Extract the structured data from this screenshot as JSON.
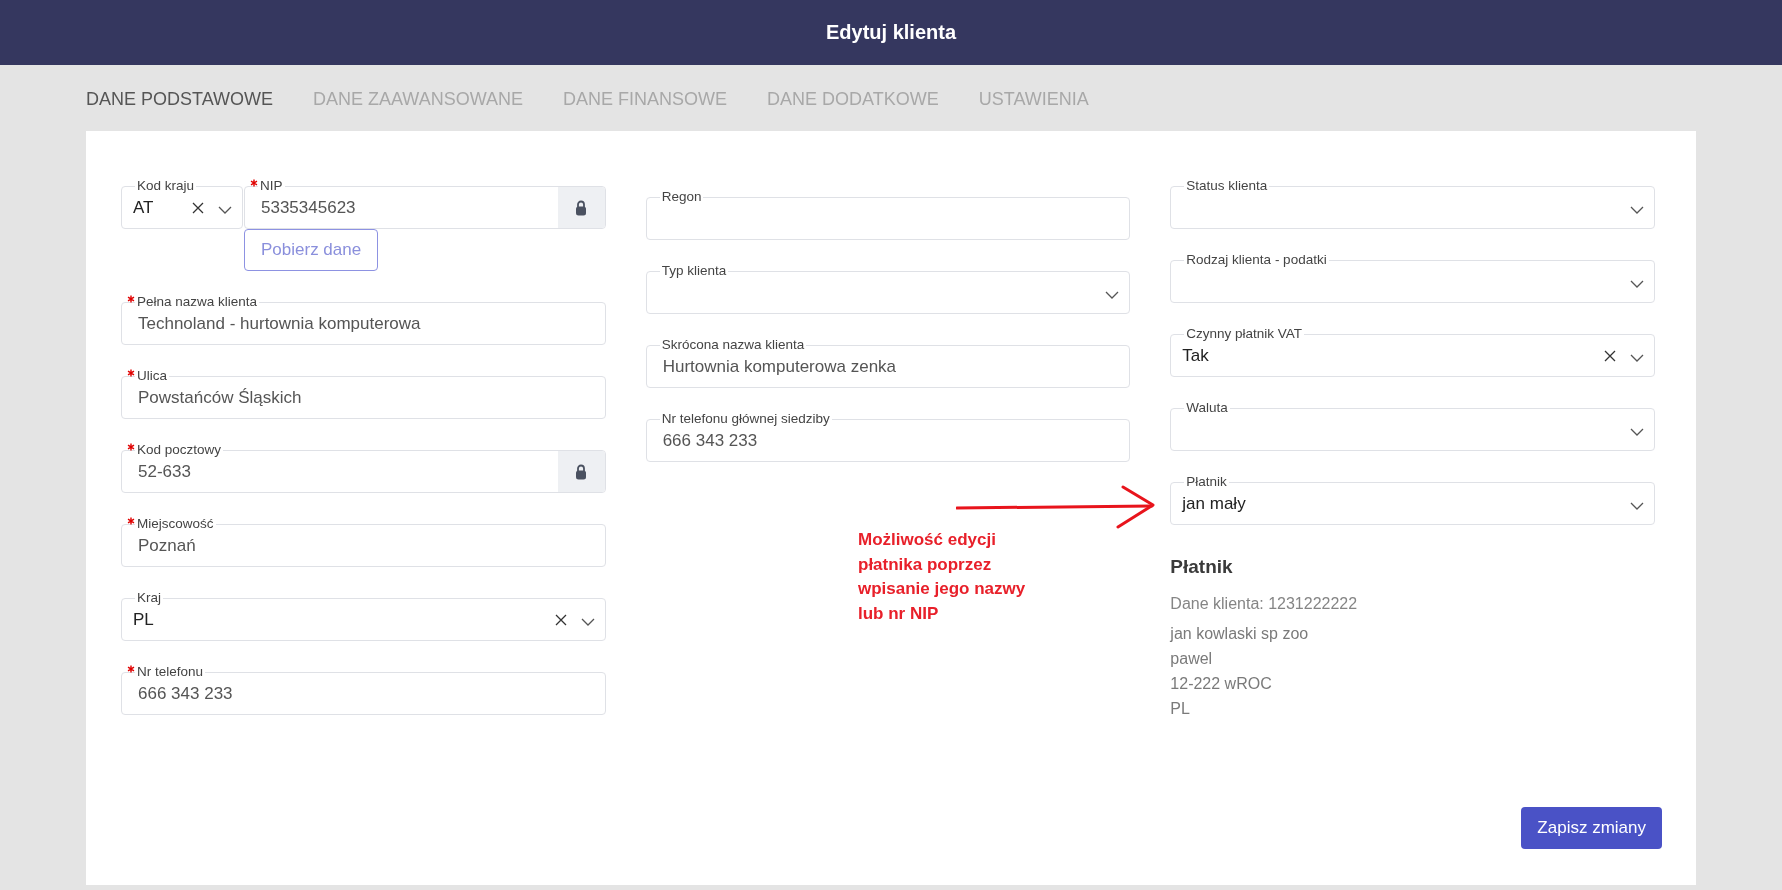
{
  "header": {
    "title": "Edytuj klienta"
  },
  "tabs": [
    {
      "label": "DANE PODSTAWOWE",
      "selected": true
    },
    {
      "label": "DANE ZAAWANSOWANE",
      "selected": false
    },
    {
      "label": "DANE FINANSOWE",
      "selected": false
    },
    {
      "label": "DANE DODATKOWE",
      "selected": false
    },
    {
      "label": "USTAWIENIA",
      "selected": false
    }
  ],
  "form": {
    "columns": [
      {
        "items": [
          {
            "kind": "pair",
            "fields": [
              {
                "kind": "select",
                "label": "Kod kraju",
                "value": "AT",
                "required": false,
                "clearable": true
              },
              {
                "kind": "text",
                "label": "NIP",
                "value": "5335345623",
                "required": true,
                "locked": true,
                "button": "Pobierz dane"
              }
            ]
          },
          {
            "kind": "text",
            "label": "Pełna nazwa klienta",
            "value": "Technoland - hurtownia komputerowa",
            "required": true,
            "locked": false
          },
          {
            "kind": "text",
            "label": "Ulica",
            "value": "Powstańców Śląskich",
            "required": true,
            "locked": false
          },
          {
            "kind": "text",
            "label": "Kod pocztowy",
            "value": "52-633",
            "required": true,
            "locked": true
          },
          {
            "kind": "text",
            "label": "Miejscowość",
            "value": "Poznań",
            "required": true,
            "locked": false
          },
          {
            "kind": "select",
            "label": "Kraj",
            "value": "PL",
            "required": false,
            "clearable": true
          },
          {
            "kind": "text",
            "label": "Nr telefonu",
            "value": "666 343 233",
            "required": true,
            "locked": false
          }
        ]
      },
      {
        "items": [
          {
            "kind": "text",
            "label": "Regon",
            "required": false,
            "locked": false
          },
          {
            "kind": "select",
            "label": "Typ klienta",
            "required": false,
            "clearable": false
          },
          {
            "kind": "text",
            "label": "Skrócona nazwa klienta",
            "value": "Hurtownia komputerowa zenka",
            "required": false,
            "locked": false
          },
          {
            "kind": "text",
            "label": "Nr telefonu głównej siedziby",
            "value": "666 343 233",
            "required": false,
            "locked": false
          }
        ]
      },
      {
        "items": [
          {
            "kind": "select",
            "label": "Status klienta",
            "required": false,
            "clearable": false
          },
          {
            "kind": "select",
            "label": "Rodzaj klienta - podatki",
            "required": false,
            "clearable": false
          },
          {
            "kind": "select",
            "label": "Czynny płatnik VAT",
            "value": "Tak",
            "required": false,
            "clearable": true
          },
          {
            "kind": "select",
            "label": "Waluta",
            "required": false,
            "clearable": false
          },
          {
            "kind": "select",
            "label": "Płatnik",
            "value": "jan mały",
            "required": false,
            "clearable": false
          },
          {
            "kind": "info",
            "title": "Płatnik",
            "subtitle": "Dane klienta: 1231222222",
            "lines": [
              "jan kowlaski sp zoo",
              "pawel",
              "12-222 wROC",
              "PL"
            ]
          }
        ]
      }
    ],
    "save_button": "Zapisz zmiany"
  },
  "annotation": {
    "text": "Możliwość edycji płatnika poprzez wpisanie jego nazwy lub nr NIP"
  }
}
